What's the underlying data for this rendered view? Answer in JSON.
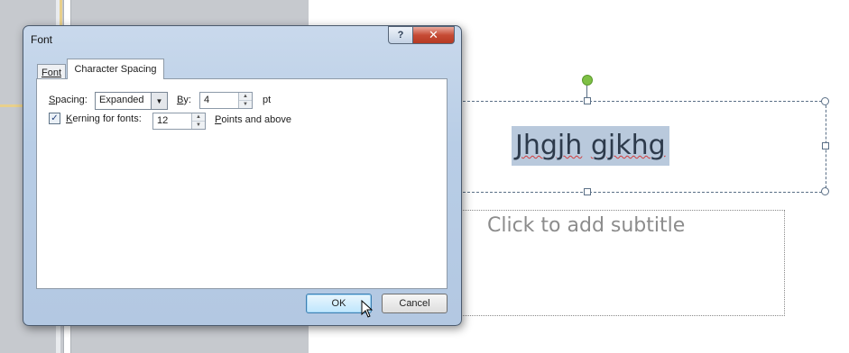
{
  "dialog": {
    "title": "Font",
    "help_label": "?",
    "close_label": "✕",
    "tabs": [
      {
        "label": "Font",
        "active": false
      },
      {
        "label": "Character Spacing",
        "active": true
      }
    ],
    "spacing": {
      "label_accel": "S",
      "label_rest": "pacing:",
      "value": "Expanded",
      "arrow": "▼"
    },
    "by": {
      "label_accel": "B",
      "label_rest": "y:",
      "value": "4",
      "unit": "pt"
    },
    "kerning": {
      "checked": true,
      "check_glyph": "✓",
      "label_accel": "K",
      "label_rest": "erning for fonts:",
      "value": "12",
      "suffix_accel": "P",
      "suffix_rest": "oints and above"
    },
    "ok_label": "OK",
    "cancel_label": "Cancel"
  },
  "slide": {
    "title_word1": "Jhgjh",
    "title_word2": "gjkhg",
    "subtitle_placeholder": "Click to add subtitle"
  },
  "colors": {
    "selection_highlight": "#b9c9dc",
    "rotate_handle": "#7ec045",
    "dialog_frame": "#b8cde6"
  }
}
